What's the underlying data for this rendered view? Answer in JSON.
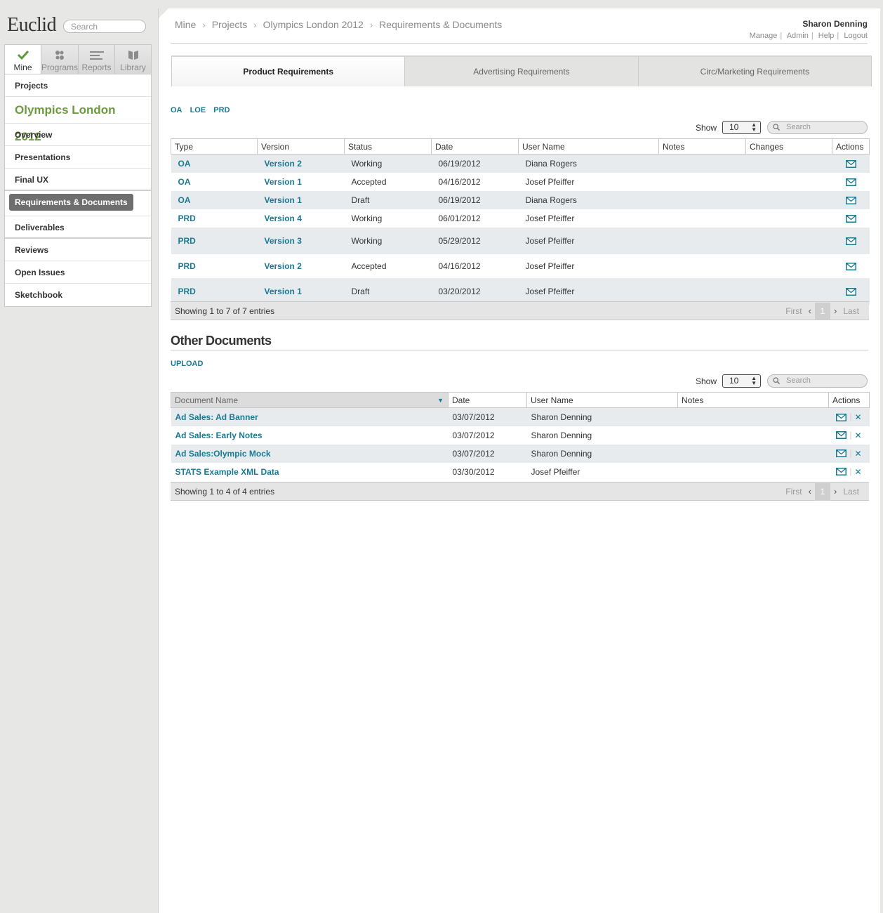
{
  "app": {
    "logo": "Euclid",
    "search_placeholder": "Search"
  },
  "nav_tabs": [
    {
      "label": "Mine",
      "icon": "checkmark-icon",
      "active": true
    },
    {
      "label": "Programs",
      "icon": "programs-icon",
      "active": false
    },
    {
      "label": "Reports",
      "icon": "reports-icon",
      "active": false
    },
    {
      "label": "Library",
      "icon": "library-icon",
      "active": false
    }
  ],
  "sidebar": {
    "projects": "Projects",
    "current_project": "Olympics London 2012",
    "items": [
      "Overview",
      "Presentations",
      "Final UX",
      "Requirements & Documents",
      "Deliverables",
      "Reviews",
      "Open Issues",
      "Sketchbook"
    ],
    "active_item": "Requirements & Documents"
  },
  "breadcrumb": [
    "Mine",
    "Projects",
    "Olympics London 2012",
    "Requirements & Documents"
  ],
  "user": {
    "name": "Sharon Denning",
    "links": [
      "Manage",
      "Admin",
      "Help",
      "Logout"
    ]
  },
  "req_tabs": [
    {
      "label": "Product Requirements",
      "active": true
    },
    {
      "label": "Advertising Requirements",
      "active": false
    },
    {
      "label": "Circ/Marketing Requirements",
      "active": false
    }
  ],
  "filters": [
    "OA",
    "LOE",
    "PRD"
  ],
  "table_controls": {
    "show_label": "Show",
    "show_value": "10",
    "search_placeholder": "Search"
  },
  "requirements_table": {
    "columns": [
      "Type",
      "Version",
      "Status",
      "Date",
      "User Name",
      "Notes",
      "Changes",
      "Actions"
    ],
    "rows": [
      {
        "type": "OA",
        "version": "Version 2",
        "status": "Working",
        "date": "06/19/2012",
        "user": "Diana Rogers"
      },
      {
        "type": "OA",
        "version": "Version 1",
        "status": "Accepted",
        "date": "04/16/2012",
        "user": "Josef Pfeiffer"
      },
      {
        "type": "OA",
        "version": "Version 1",
        "status": "Draft",
        "date": "06/19/2012",
        "user": "Diana Rogers"
      },
      {
        "type": "PRD",
        "version": "Version 4",
        "status": "Working",
        "date": "06/01/2012",
        "user": "Josef Pfeiffer"
      },
      {
        "type": "PRD",
        "version": "Version 3",
        "status": "Working",
        "date": "05/29/2012",
        "user": "Josef Pfeiffer"
      },
      {
        "type": "PRD",
        "version": "Version 2",
        "status": "Accepted",
        "date": "04/16/2012",
        "user": "Josef Pfeiffer"
      },
      {
        "type": "PRD",
        "version": "Version 1",
        "status": "Draft",
        "date": "03/20/2012",
        "user": "Josef Pfeiffer"
      }
    ],
    "footer": "Showing 1 to 7 of 7 entries"
  },
  "pager": {
    "first": "First",
    "current": "1",
    "last": "Last"
  },
  "other_documents": {
    "title": "Other Documents",
    "upload": "UPLOAD",
    "columns": [
      "Document Name",
      "Date",
      "User Name",
      "Notes",
      "Actions"
    ],
    "rows": [
      {
        "name": "Ad Sales: Ad Banner",
        "date": "03/07/2012",
        "user": "Sharon Denning"
      },
      {
        "name": "Ad Sales: Early Notes",
        "date": "03/07/2012",
        "user": "Sharon Denning"
      },
      {
        "name": "Ad Sales:Olympic Mock",
        "date": "03/07/2012",
        "user": "Sharon Denning"
      },
      {
        "name": "STATS Example XML Data",
        "date": "03/30/2012",
        "user": "Josef Pfeiffer"
      }
    ],
    "footer": "Showing 1 to 4 of 4 entries"
  },
  "colors": {
    "accent": "#1a7a93",
    "project_green": "#6c9a3e",
    "check_green": "#5a9a3a"
  }
}
